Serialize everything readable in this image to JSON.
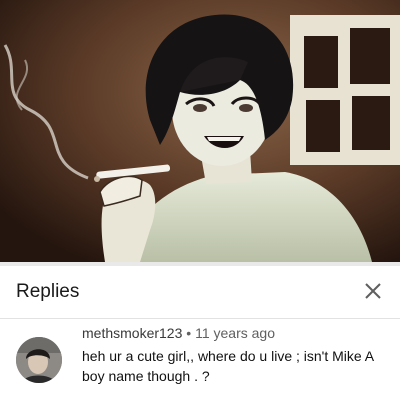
{
  "panel": {
    "title": "Replies",
    "close_icon": "close-icon"
  },
  "comment": {
    "author": "methsmoker123",
    "separator": "•",
    "time": "11 years ago",
    "text": "heh ur a cute girl,, where do u live ; isn't Mike A boy name though . ?"
  },
  "colors": {
    "panel_background": "#ffffff",
    "text_primary": "#111111",
    "text_secondary": "#606060"
  }
}
